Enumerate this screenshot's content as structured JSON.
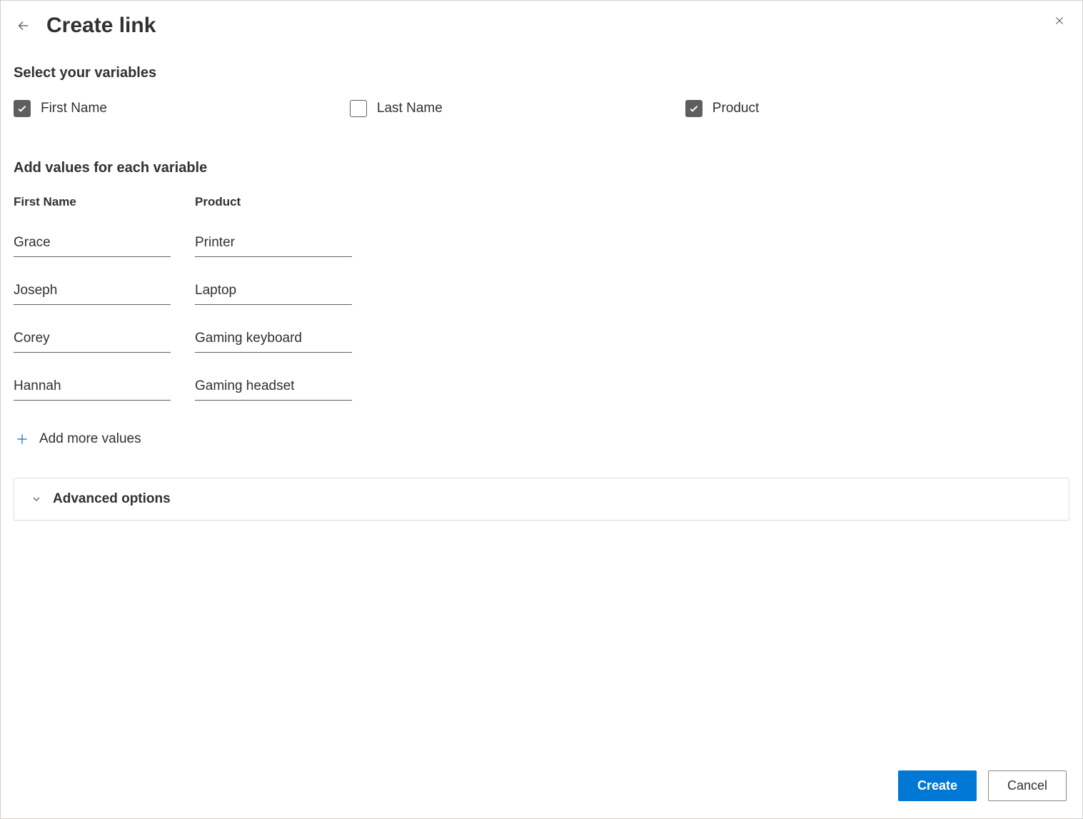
{
  "header": {
    "title": "Create link"
  },
  "sections": {
    "select_variables_heading": "Select your variables",
    "add_values_heading": "Add values for each variable"
  },
  "variables": [
    {
      "label": "First Name",
      "checked": true
    },
    {
      "label": "Last Name",
      "checked": false
    },
    {
      "label": "Product",
      "checked": true
    }
  ],
  "columns": [
    {
      "header": "First Name"
    },
    {
      "header": "Product"
    }
  ],
  "rows": [
    {
      "first_name": "Grace",
      "product": "Printer"
    },
    {
      "first_name": "Joseph",
      "product": "Laptop"
    },
    {
      "first_name": "Corey",
      "product": "Gaming keyboard"
    },
    {
      "first_name": "Hannah",
      "product": "Gaming headset"
    }
  ],
  "actions": {
    "add_more_label": "Add more values",
    "advanced_label": "Advanced options",
    "create_label": "Create",
    "cancel_label": "Cancel"
  }
}
